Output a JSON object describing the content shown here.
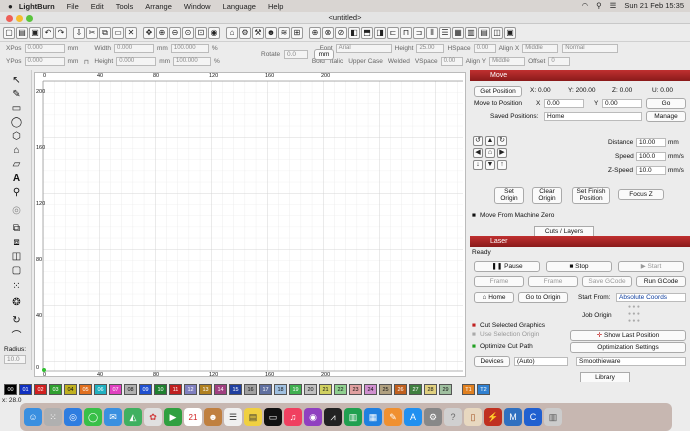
{
  "menubar": {
    "app": "LightBurn",
    "items": [
      "File",
      "Edit",
      "Tools",
      "Arrange",
      "Window",
      "Language",
      "Help"
    ],
    "clock": "Sun 21 Feb  15:35"
  },
  "window": {
    "title": "<untitled>"
  },
  "props": {
    "xpos_label": "XPos",
    "xpos_val": "0.000",
    "ypos_label": "YPos",
    "ypos_val": "0.000",
    "unit": "mm",
    "width_label": "Width",
    "width_val": "0.000",
    "height_label": "Height",
    "height_val": "0.000",
    "pct_w": "100.000",
    "pct_h": "100.000",
    "pct": "%",
    "rotate_label": "Rotate",
    "rotate_val": "0.0",
    "mm_btn": "mm",
    "font_label": "Font",
    "font_val": "Arial",
    "fheight_label": "Height",
    "fheight_val": "25.00",
    "hspace_label": "HSpace",
    "hspace_val": "0.00",
    "vspace_label": "VSpace",
    "vspace_val": "0.00",
    "alignx_label": "Align X",
    "alignx_val": "Middle",
    "aligny_label": "Align Y",
    "aligny_val": "Middle",
    "normal_val": "Normal",
    "offset_label": "Offset",
    "offset_val": "0",
    "bold": "Bold",
    "italic": "Italic",
    "upper": "Upper Case",
    "welded": "Welded"
  },
  "lefttools": {
    "radius_label": "Radius:",
    "radius_val": "10.0"
  },
  "canvas": {
    "top_ticks": [
      "0",
      "40",
      "80",
      "120",
      "160",
      "200"
    ],
    "bottom_ticks": [
      "0",
      "40",
      "80",
      "120",
      "160",
      "200"
    ],
    "left_ticks": [
      "200",
      "160",
      "120",
      "80",
      "40",
      "0"
    ]
  },
  "move": {
    "header": "Move",
    "get_position": "Get Position",
    "x_readout": "X: 0.00",
    "y_readout": "Y: 200.00",
    "z_readout": "Z: 0.00",
    "u_readout": "U: 0.00",
    "move_to_position": "Move to Position",
    "x_label": "X",
    "x_val": "0.00",
    "y_label": "Y",
    "y_val": "0.00",
    "go": "Go",
    "saved_positions": "Saved Positions:",
    "saved_val": "Home",
    "manage": "Manage",
    "distance_label": "Distance",
    "distance_val": "10.00",
    "distance_unit": "mm",
    "speed_label": "Speed",
    "speed_val": "100.0",
    "speed_unit": "mm/s",
    "zspeed_label": "Z-Speed",
    "zspeed_val": "10.0",
    "zspeed_unit": "mm/s",
    "set_origin": "Set Origin",
    "clear_origin": "Clear Origin",
    "set_finish": "Set Finish Position",
    "focus_z": "Focus Z",
    "move_from_zero": "Move From Machine Zero",
    "cuts_layers": "Cuts / Layers"
  },
  "laser": {
    "header": "Laser",
    "status": "Ready",
    "pause": "Pause",
    "stop": "Stop",
    "start": "Start",
    "frame1": "Frame",
    "frame2": "Frame",
    "save_gcode": "Save GCode",
    "run_gcode": "Run GCode",
    "home": "Home",
    "go_to_origin": "Go to Origin",
    "start_from_label": "Start From:",
    "start_from_val": "Absolute Coords",
    "job_origin": "Job Origin",
    "cut_selected": "Cut Selected Graphics",
    "use_selection": "Use Selection Origin",
    "show_last": "Show Last Position",
    "optimize_cut": "Optimize Cut Path",
    "optimization_settings": "Optimization Settings",
    "devices": "Devices",
    "auto": "(Auto)",
    "controller": "Smoothieware",
    "library": "Library"
  },
  "palette": [
    {
      "label": "00",
      "color": "#000000"
    },
    {
      "label": "01",
      "color": "#1030c0"
    },
    {
      "label": "02",
      "color": "#d02020"
    },
    {
      "label": "03",
      "color": "#30a030"
    },
    {
      "label": "04",
      "color": "#c0b020"
    },
    {
      "label": "05",
      "color": "#e07020"
    },
    {
      "label": "06",
      "color": "#20b0c0"
    },
    {
      "label": "07",
      "color": "#e040c0"
    },
    {
      "label": "08",
      "color": "#b0b0b0"
    },
    {
      "label": "09",
      "color": "#2050d0"
    },
    {
      "label": "10",
      "color": "#208030"
    },
    {
      "label": "11",
      "color": "#c02020"
    },
    {
      "label": "12",
      "color": "#8080c0"
    },
    {
      "label": "13",
      "color": "#b08020"
    },
    {
      "label": "14",
      "color": "#a04080"
    },
    {
      "label": "15",
      "color": "#2040a0"
    },
    {
      "label": "16",
      "color": "#a0a0a0"
    },
    {
      "label": "17",
      "color": "#6070a0"
    },
    {
      "label": "18",
      "color": "#a0c0e0"
    },
    {
      "label": "19",
      "color": "#40b050"
    },
    {
      "label": "20",
      "color": "#c0c0c0"
    },
    {
      "label": "21",
      "color": "#d0d060"
    },
    {
      "label": "22",
      "color": "#90d090"
    },
    {
      "label": "23",
      "color": "#e0a0a0"
    },
    {
      "label": "24",
      "color": "#d090d0"
    },
    {
      "label": "25",
      "color": "#b0a080"
    },
    {
      "label": "26",
      "color": "#c06020"
    },
    {
      "label": "27",
      "color": "#408040"
    },
    {
      "label": "28",
      "color": "#e0d080"
    },
    {
      "label": "29",
      "color": "#a0c0a0"
    },
    {
      "label": "T1",
      "color": "#e08020"
    },
    {
      "label": "T2",
      "color": "#3080d0"
    }
  ],
  "status": {
    "coords": "x: 28.0"
  },
  "dock": {
    "date_badge": "21"
  },
  "colors": {
    "accent": "#b02020"
  }
}
